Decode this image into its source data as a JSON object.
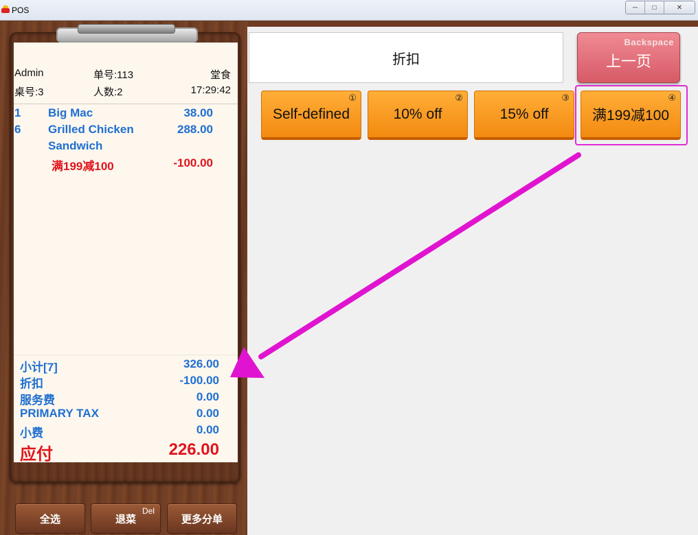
{
  "window": {
    "title": "POS"
  },
  "receipt": {
    "header": {
      "user": "Admin",
      "order_no": "单号:113",
      "mode": "堂食",
      "table": "桌号:3",
      "guests": "人数:2",
      "time": "17:29:42"
    },
    "items": [
      {
        "qty": "1",
        "name": "Big Mac",
        "price": "38.00"
      },
      {
        "qty": "6",
        "name_line1": "Grilled Chicken",
        "name_line2": "Sandwich",
        "price": "288.00"
      }
    ],
    "discount_line": {
      "name": "满199减100",
      "amount": "-100.00"
    },
    "totals": {
      "subtotal_label": "小计[7]",
      "subtotal": "326.00",
      "discount_label": "折扣",
      "discount": "-100.00",
      "service_label": "服务费",
      "service": "0.00",
      "tax_label": "PRIMARY TAX",
      "tax": "0.00",
      "tip_label": "小费",
      "tip": "0.00",
      "due_label": "应付",
      "due": "226.00"
    }
  },
  "bottom_buttons": {
    "select_all": "全选",
    "return_dish": "退菜",
    "return_dish_key": "Del",
    "more_split": "更多分单"
  },
  "panel": {
    "title": "折扣",
    "back": {
      "key": "Backspace",
      "label": "上一页"
    }
  },
  "discounts": [
    {
      "label": "Self-defined",
      "index": "①"
    },
    {
      "label": "10% off",
      "index": "②"
    },
    {
      "label": "15% off",
      "index": "③"
    },
    {
      "label": "满199减100",
      "index": "④"
    }
  ],
  "colors": {
    "accent_orange": "#f5921a",
    "back_pink": "#e0707a",
    "highlight_magenta": "#e02ad3",
    "item_blue": "#1f6fd1",
    "discount_red": "#e0141c"
  }
}
